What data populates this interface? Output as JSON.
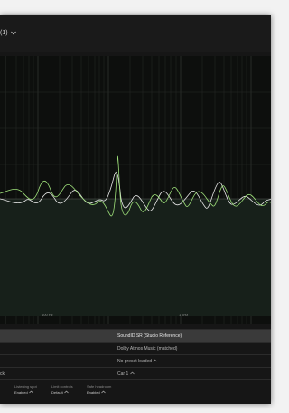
{
  "header": {
    "preset_title": "(1)"
  },
  "graph": {
    "tick_100": "100 Hz",
    "tick_1k": "1 kHz"
  },
  "info": {
    "target_curve": "SoundID SR (Studio Reference)",
    "translation": "Dolby Atmos Music (matched)",
    "preset_status": "No preset loaded",
    "device_label": "ck",
    "device_value": "Car 1"
  },
  "footer": {
    "listening_spot": {
      "title": "Listening spot",
      "value": "Enabled"
    },
    "limit_controls": {
      "title": "Limit controls",
      "value": "Default"
    },
    "safe_headroom": {
      "title": "Safe headroom",
      "value": "Enabled"
    }
  },
  "colors": {
    "accent_green": "#9ee07a",
    "curve_white": "#e6e6e6"
  }
}
